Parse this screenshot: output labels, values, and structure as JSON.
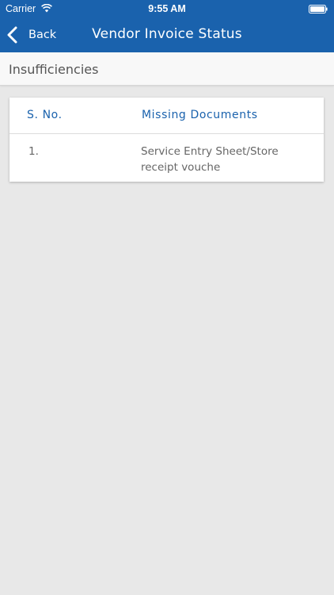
{
  "status_bar": {
    "carrier": "Carrier",
    "time": "9:55 AM",
    "wifi_icon": "wifi-icon",
    "battery_icon": "battery-icon"
  },
  "nav": {
    "back_label": "Back",
    "back_icon": "chevron-left-icon",
    "title": "Vendor Invoice Status"
  },
  "section": {
    "title": "Insufficiencies"
  },
  "table": {
    "headers": [
      "S. No.",
      "Missing Documents"
    ],
    "rows": [
      {
        "sno": "1.",
        "document": "Service Entry Sheet/Store receipt vouche"
      }
    ]
  },
  "colors": {
    "primary": "#1a62ad",
    "background": "#e8e8e8",
    "card": "#ffffff"
  }
}
